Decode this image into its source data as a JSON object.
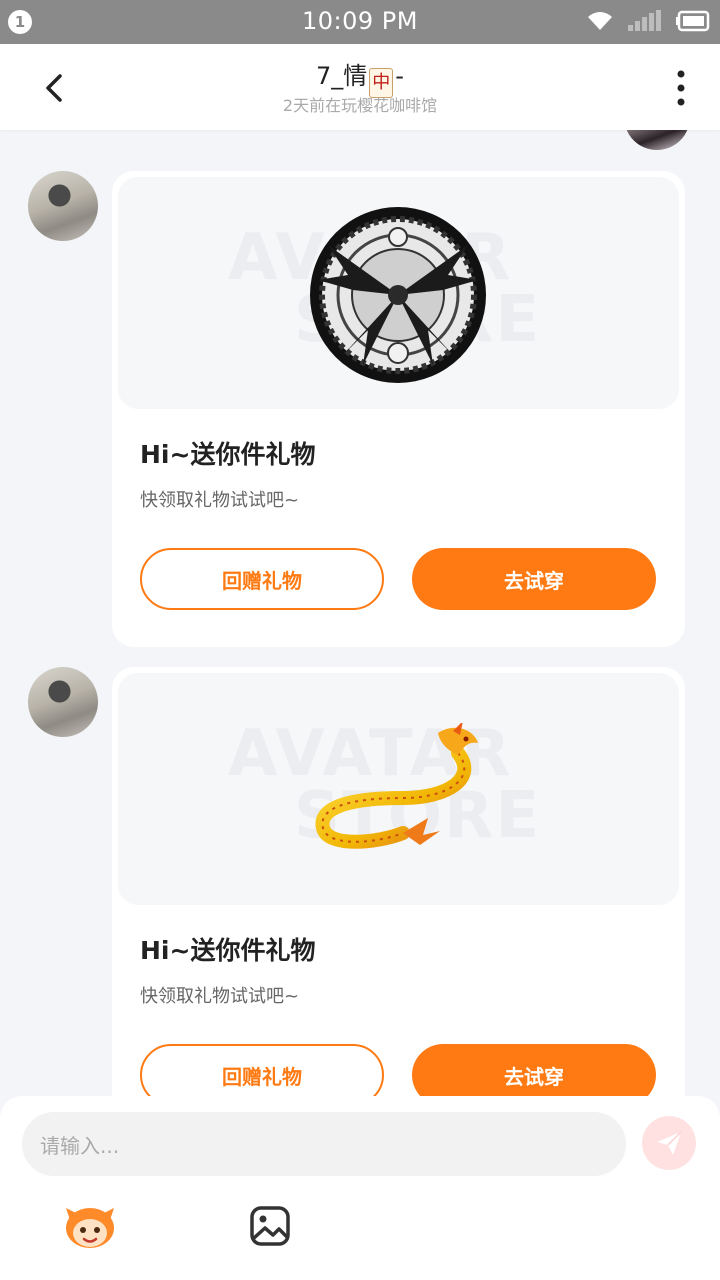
{
  "status_bar": {
    "notification_count": "1",
    "time": "10:09 PM"
  },
  "header": {
    "title_prefix": "7_情",
    "title_suffix": "-",
    "title_emoji_char": "中",
    "subtitle": "2天前在玩樱花咖啡馆"
  },
  "messages": [
    {
      "gift_title": "Hi~送你件礼物",
      "gift_desc": "快领取礼物试试吧~",
      "return_button": "回赠礼物",
      "try_button": "去试穿",
      "watermark": [
        "AVATAR",
        "STORE"
      ],
      "item_icon": "winged-emblem-badge"
    },
    {
      "gift_title": "Hi~送你件礼物",
      "gift_desc": "快领取礼物试试吧~",
      "return_button": "回赠礼物",
      "try_button": "去试穿",
      "watermark": [
        "AVATAR",
        "STORE"
      ],
      "item_icon": "golden-dragon"
    }
  ],
  "composer": {
    "placeholder": "请输入..."
  },
  "colors": {
    "accent": "#ff7a12",
    "send_bg": "#ffe1e1",
    "status_bar": "#8a8a8a"
  }
}
